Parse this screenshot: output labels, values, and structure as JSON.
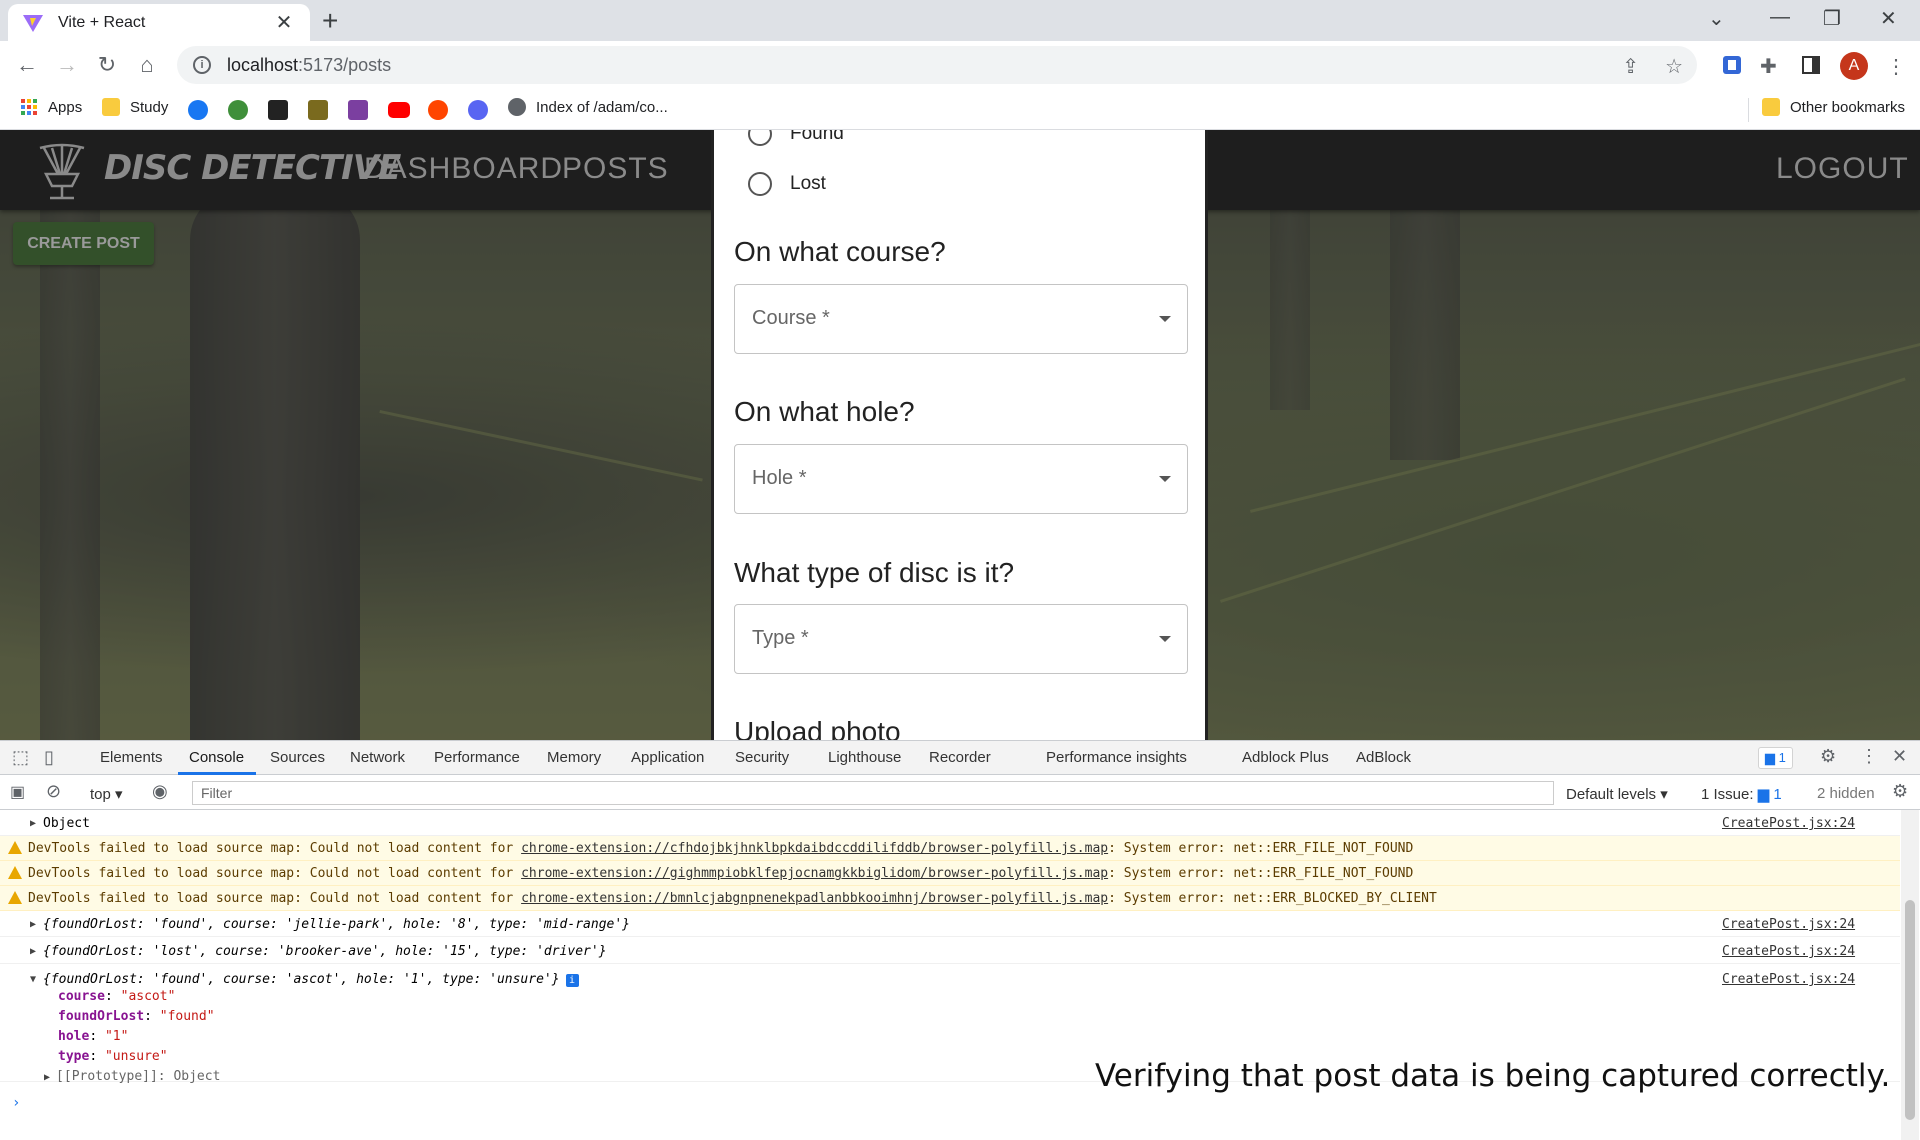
{
  "browser": {
    "tab_title": "Vite + React",
    "url_host": "localhost",
    "url_rest": ":5173/posts",
    "bookmarks": [
      {
        "label": "Apps"
      },
      {
        "label": "Study"
      },
      {
        "label": "Index of /adam/co..."
      }
    ],
    "other_bookmarks": "Other bookmarks",
    "profile_initial": "A"
  },
  "app": {
    "logo_text": "DISC DETECTIVE",
    "nav": {
      "dashboard": "DASHBOARD",
      "posts": "POSTS",
      "logout": "LOGOUT"
    },
    "create_post": "CREATE POST"
  },
  "form": {
    "radio_found": "Found",
    "radio_lost": "Lost",
    "course_question": "On what course?",
    "course_placeholder": "Course *",
    "hole_question": "On what hole?",
    "hole_placeholder": "Hole *",
    "type_question": "What type of disc is it?",
    "type_placeholder": "Type *",
    "upload_question": "Upload photo"
  },
  "devtools": {
    "tabs": [
      "Elements",
      "Console",
      "Sources",
      "Network",
      "Performance",
      "Memory",
      "Application",
      "Security",
      "Lighthouse",
      "Recorder",
      "Performance insights",
      "Adblock Plus",
      "AdBlock"
    ],
    "active_tab": "Console",
    "message_count": "1",
    "context": "top",
    "filter_placeholder": "Filter",
    "levels": "Default levels",
    "issues_label": "1 Issue:",
    "issues_count": "1",
    "hidden": "2 hidden",
    "rows": {
      "object_label": "Object",
      "src": "CreatePost.jsx:24",
      "warn1_pre": "DevTools failed to load source map: Could not load content for ",
      "warn1_link": "chrome-extension://cfhdojbkjhnklbpkdaibdccddilifddb/browser-polyfill.js.map",
      "warn1_post": ": System error: net::ERR_FILE_NOT_FOUND",
      "warn2_pre": "DevTools failed to load source map: Could not load content for ",
      "warn2_link": "chrome-extension://gighmmpiobklfepjocnamgkkbiglidom/browser-polyfill.js.map",
      "warn2_post": ": System error: net::ERR_FILE_NOT_FOUND",
      "warn3_pre": "DevTools failed to load source map: Could not load content for ",
      "warn3_link": "chrome-extension://bmnlcjabgnpnenekpadlanbbkooimhnj/browser-polyfill.js.map",
      "warn3_post": ": System error: net::ERR_BLOCKED_BY_CLIENT",
      "log1": "{foundOrLost: 'found', course: 'jellie-park', hole: '8', type: 'mid-range'}",
      "log2": "{foundOrLost: 'lost', course: 'brooker-ave', hole: '15', type: 'driver'}",
      "log3": "{foundOrLost: 'found', course: 'ascot', hole: '1', type: 'unsure'}",
      "prop_course": "course",
      "val_course": "\"ascot\"",
      "prop_found": "foundOrLost",
      "val_found": "\"found\"",
      "prop_hole": "hole",
      "val_hole": "\"1\"",
      "prop_type": "type",
      "val_type": "\"unsure\"",
      "proto": "[[Prototype]]: Object"
    }
  },
  "caption": "Verifying that post data is being captured correctly.",
  "colors": {
    "appbar": "#1e1e1e",
    "create_post": "#33502a",
    "accent": "#1a73e8"
  }
}
